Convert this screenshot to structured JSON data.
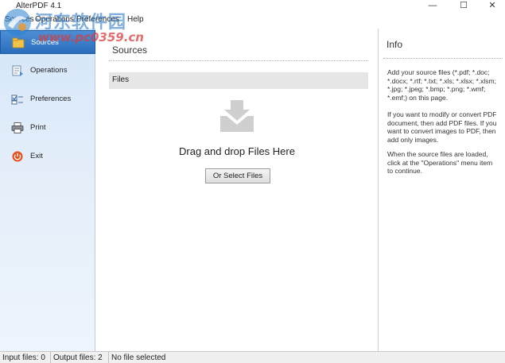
{
  "window": {
    "title": "AlterPDF 4.1",
    "controls": {
      "minimize": "—",
      "maximize": "☐",
      "close": "✕"
    }
  },
  "menu": {
    "items": [
      "Sources",
      "Operations",
      "Preferences",
      "Help"
    ]
  },
  "watermark": {
    "name": "河东软件园",
    "url": "www.pc0359.cn"
  },
  "sidebar": {
    "items": [
      {
        "label": "Sources",
        "icon": "sources-icon",
        "active": true
      },
      {
        "label": "Operations",
        "icon": "operations-icon"
      },
      {
        "label": "Preferences",
        "icon": "preferences-icon"
      },
      {
        "label": "Print",
        "icon": "print-icon"
      },
      {
        "label": "Exit",
        "icon": "exit-icon"
      }
    ]
  },
  "main": {
    "title": "Sources",
    "files_header": "Files",
    "drop_text": "Drag and drop Files Here",
    "select_button": "Or Select Files"
  },
  "info": {
    "title": "Info",
    "paragraphs": [
      "Add your source files (*.pdf; *.doc; *.docx; *.rtf; *.txt; *.xls; *.xlsx; *.xlsm; *.jpg; *.jpeg; *.bmp; *.png; *.wmf; *.emf;) on this page.",
      "If you want to modify or convert PDF document, then add PDF files. If you want to convert images to PDF, then add only images.",
      "When the source files are loaded, click at the \"Operations\" menu item to continue."
    ]
  },
  "status": {
    "input_files": "Input files: 0",
    "output_files": "Output files: 2",
    "selection": "No file selected"
  },
  "colors": {
    "active_nav": "#2a6ebc",
    "sidebar_bg": "#d4e6f9",
    "exit_icon": "#e8501e"
  }
}
